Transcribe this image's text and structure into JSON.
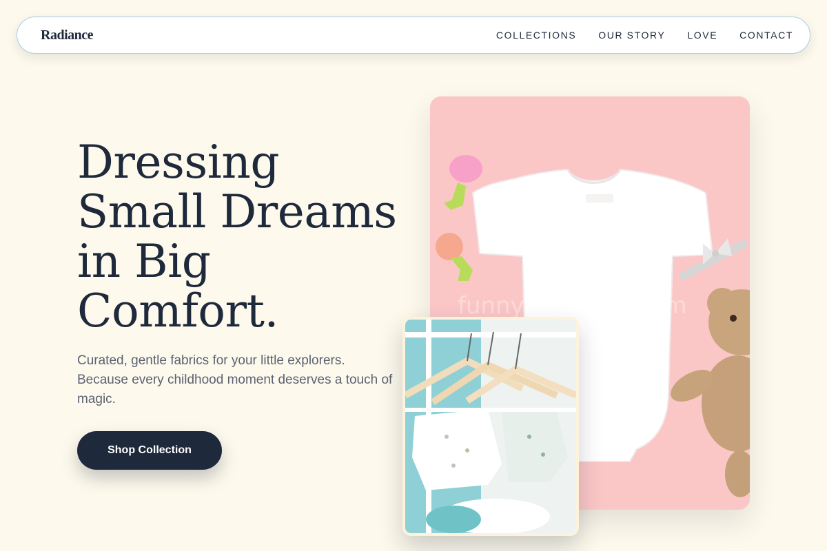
{
  "brand": {
    "name": "Radiance"
  },
  "nav": {
    "links": [
      "COLLECTIONS",
      "OUR STORY",
      "LOVE",
      "CONTACT"
    ]
  },
  "hero": {
    "title_lines": [
      "Dressing",
      "Small Dreams",
      "in Big",
      "Comfort."
    ],
    "subtitle": "Curated, gentle fabrics for your little explorers. Because every childhood moment deserves a touch of magic.",
    "cta_label": "Shop Collection"
  },
  "images": {
    "main": {
      "icon": "baby-onesie-photo",
      "background": "#fbc6c6"
    },
    "secondary": {
      "icon": "clothes-hangers-photo"
    }
  },
  "colors": {
    "background": "#fdf9ec",
    "primary": "#1e293b",
    "nav_border": "#a9cde6",
    "muted_text": "#5b6272"
  }
}
